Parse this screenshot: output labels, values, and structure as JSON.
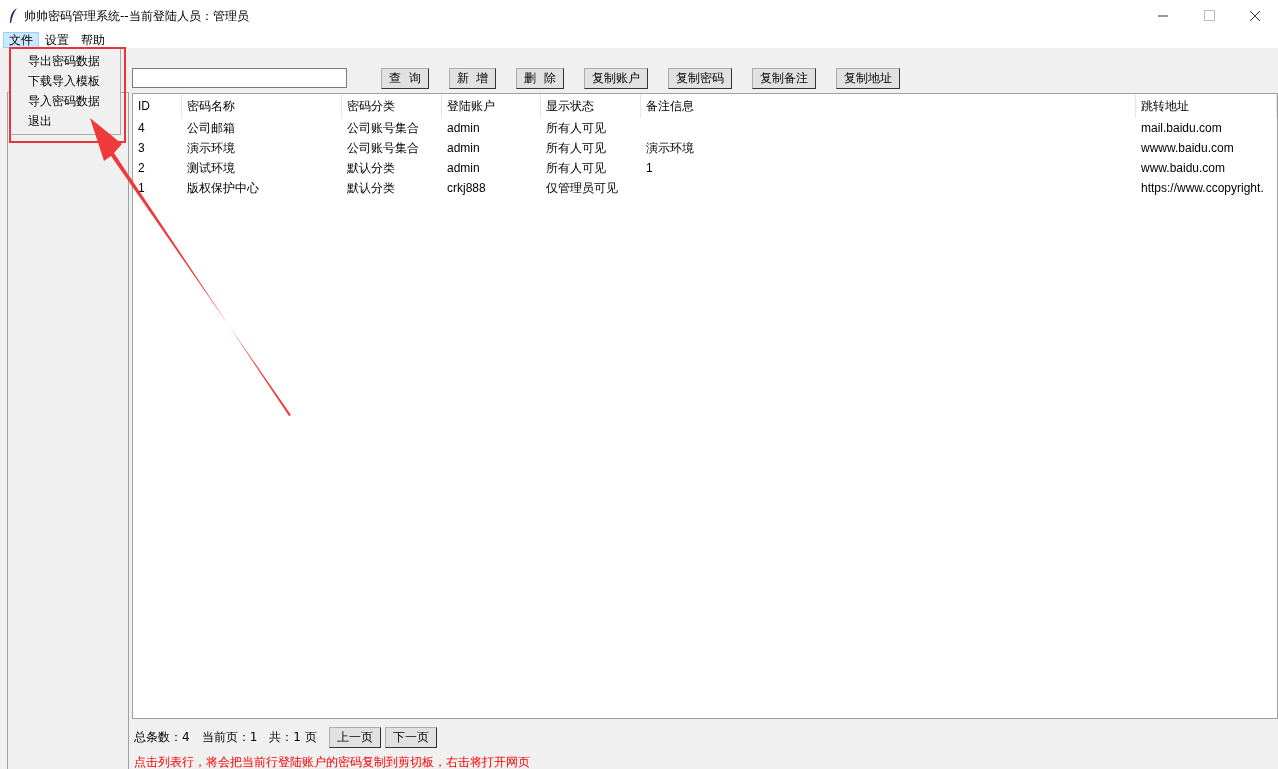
{
  "window": {
    "title": "帅帅密码管理系统--当前登陆人员：管理员"
  },
  "menus": [
    {
      "label": "文件",
      "selected": true
    },
    {
      "label": "设置",
      "selected": false
    },
    {
      "label": "帮助",
      "selected": false
    }
  ],
  "open_menu": {
    "items": [
      "导出密码数据",
      "下载导入模板",
      "导入密码数据",
      "退出"
    ]
  },
  "toolbar": {
    "buttons": [
      "查  询",
      "新  增",
      "删  除",
      "复制账户",
      "复制密码",
      "复制备注",
      "复制地址"
    ]
  },
  "table": {
    "columns": [
      "ID",
      "密码名称",
      "密码分类",
      "登陆账户",
      "显示状态",
      "备注信息",
      "跳转地址"
    ],
    "rows": [
      [
        "4",
        "公司邮箱",
        "公司账号集合",
        "admin",
        "所有人可见",
        "",
        "mail.baidu.com"
      ],
      [
        "3",
        "演示环境",
        "公司账号集合",
        "admin",
        "所有人可见",
        "演示环境",
        "wwww.baidu.com"
      ],
      [
        "2",
        "测试环境",
        "默认分类",
        "admin",
        "所有人可见",
        "1",
        "www.baidu.com"
      ],
      [
        "1",
        "版权保护中心",
        "默认分类",
        "crkj888",
        "仅管理员可见",
        "",
        "https://www.ccopyright."
      ]
    ]
  },
  "pager": {
    "total": "总条数：4",
    "current": "当前页：1",
    "pages": "共：1 页",
    "prev": "上一页",
    "next": "下一页"
  },
  "hint": "点击列表行，将会把当前行登陆账户的密码复制到剪切板，右击将打开网页",
  "annotation": {
    "kind": "arrow"
  }
}
